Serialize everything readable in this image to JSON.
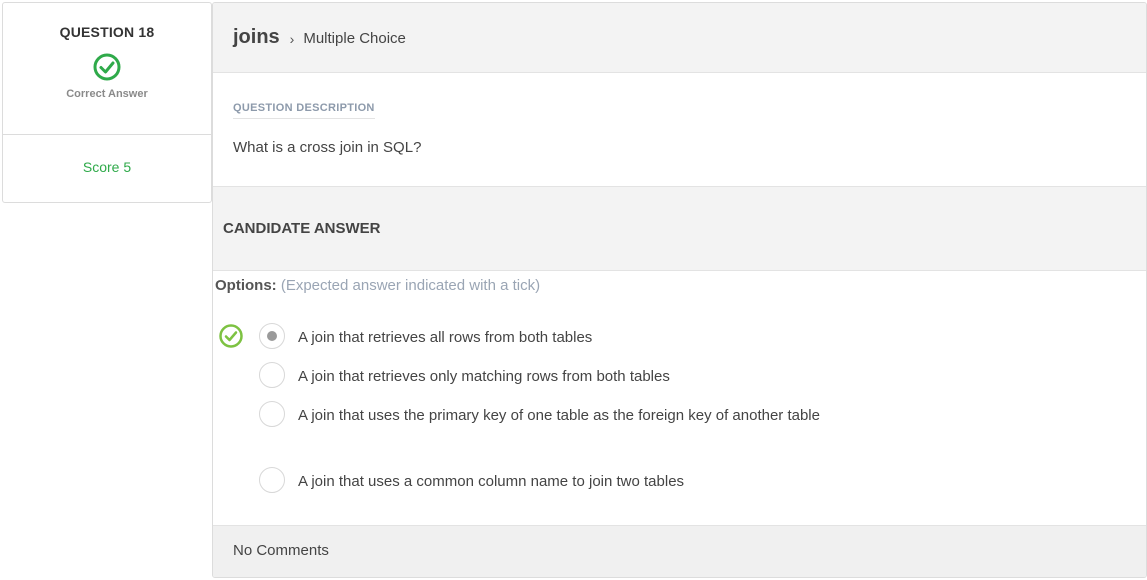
{
  "status": {
    "question_number": "QUESTION 18",
    "result_label": "Correct Answer",
    "result_icon": "check-circle-icon",
    "score": "Score 5",
    "colors": {
      "correct": "#2faa4a",
      "tick": "#7dc242"
    }
  },
  "header": {
    "topic": "joins",
    "separator": "›",
    "question_type": "Multiple Choice"
  },
  "description": {
    "heading": "QUESTION DESCRIPTION",
    "text": "What is a cross join in SQL?"
  },
  "candidate": {
    "heading": "CANDIDATE ANSWER",
    "options_label": "Options:",
    "options_hint": "(Expected answer indicated with a tick)",
    "options": [
      {
        "text": "A join that retrieves all rows from both tables",
        "selected": true,
        "expected": true
      },
      {
        "text": "A join that retrieves only matching rows from both tables",
        "selected": false,
        "expected": false
      },
      {
        "text": "A join that uses the primary key of one table as the foreign key of another table",
        "selected": false,
        "expected": false
      },
      {
        "text": "A join that uses a common column name to join two tables",
        "selected": false,
        "expected": false
      }
    ]
  },
  "comments": {
    "text": "No Comments"
  }
}
